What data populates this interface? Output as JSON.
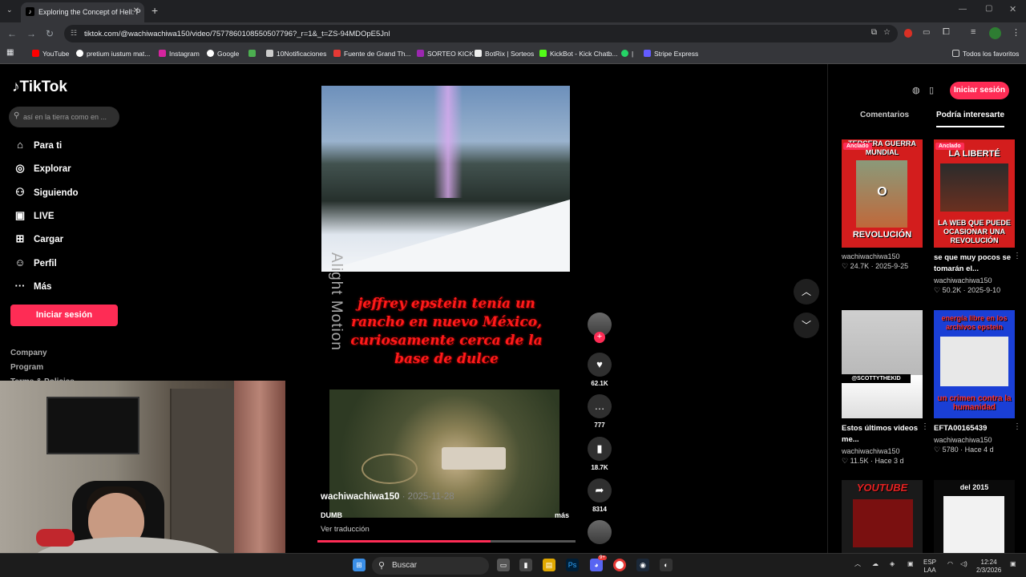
{
  "browser": {
    "tab_title": "Exploring the Concept of Hell: P",
    "url": "tiktok.com/@wachiwachiwa150/video/7577860108550507796?_r=1&_t=ZS-94MDOpE5Jnl",
    "bookmarks": [
      "YouTube",
      "pretium iustum mat...",
      "Instagram",
      "Google",
      "10Notificaciones",
      "Fuente de Grand Th...",
      "SORTEO KICK",
      "BotRix | Sorteos",
      "KickBot - Kick Chatb...",
      "|",
      "Stripe Express"
    ],
    "all_bookmarks": "Todos los favoritos"
  },
  "sidebar": {
    "logo": "TikTok",
    "search_placeholder": "así en la tierra como en ...",
    "nav": [
      {
        "label": "Para ti",
        "icon": "home-icon"
      },
      {
        "label": "Explorar",
        "icon": "compass-icon"
      },
      {
        "label": "Siguiendo",
        "icon": "following-icon"
      },
      {
        "label": "LIVE",
        "icon": "live-icon"
      },
      {
        "label": "Cargar",
        "icon": "upload-icon"
      },
      {
        "label": "Perfil",
        "icon": "profile-icon"
      },
      {
        "label": "Más",
        "icon": "more-icon"
      }
    ],
    "login": "Iniciar sesión",
    "footer": [
      "Company",
      "Program",
      "Terms & Policies"
    ]
  },
  "video": {
    "watermark": "Alight Motion",
    "overlay_text": "jeffrey epstein tenía un rancho en nuevo México, curiosamente cerca de la base de dulce",
    "author": "wachiwachiwa150",
    "date": "· 2025-11-28",
    "description": "DUMB",
    "more": "más",
    "translate": "Ver traducción",
    "progress": 0.67
  },
  "actions": {
    "likes": "62.1K",
    "comments": "777",
    "saves": "18.7K",
    "shares": "8314"
  },
  "right_panel": {
    "login": "Iniciar sesión",
    "tabs": [
      "Comentarios",
      "Podría interesarte"
    ],
    "pinned_label": "Anclado",
    "cards": [
      {
        "thumb_top": "TERCERA GUERRA MUNDIAL",
        "thumb_mid": "O",
        "thumb_bottom": "REVOLUCIÓN",
        "title": "",
        "user": "wachiwachiwa150",
        "likes": "24.7K",
        "date": "2025-9-25"
      },
      {
        "thumb_top": "LA LIBERTÉ",
        "thumb_bottom": "LA WEB QUE PUEDE OCASIONAR UNA REVOLUCIÓN",
        "title": "se que muy pocos se tomarán el...",
        "user": "wachiwachiwa150",
        "likes": "50.2K",
        "date": "2025-9-10"
      },
      {
        "thumb_top": "@SCOTTYTHEKID",
        "title": "Estos últimos videos me...",
        "user": "wachiwachiwa150",
        "likes": "11.5K",
        "date": "Hace 3 d"
      },
      {
        "thumb_top": "energía libre en los archivos epstein",
        "thumb_bottom": "un crimen contra la humanidad",
        "title": "EFTA00165439",
        "user": "wachiwachiwa150",
        "likes": "5780",
        "date": "Hace 4 d"
      },
      {
        "thumb_top": "YOUTUBE"
      },
      {
        "thumb_top": "del 2015"
      }
    ]
  },
  "taskbar": {
    "search": "Buscar",
    "lang": "ESP",
    "lang2": "LAA",
    "time": "12:24",
    "date": "2/3/2026",
    "discord_badge": "9+"
  }
}
